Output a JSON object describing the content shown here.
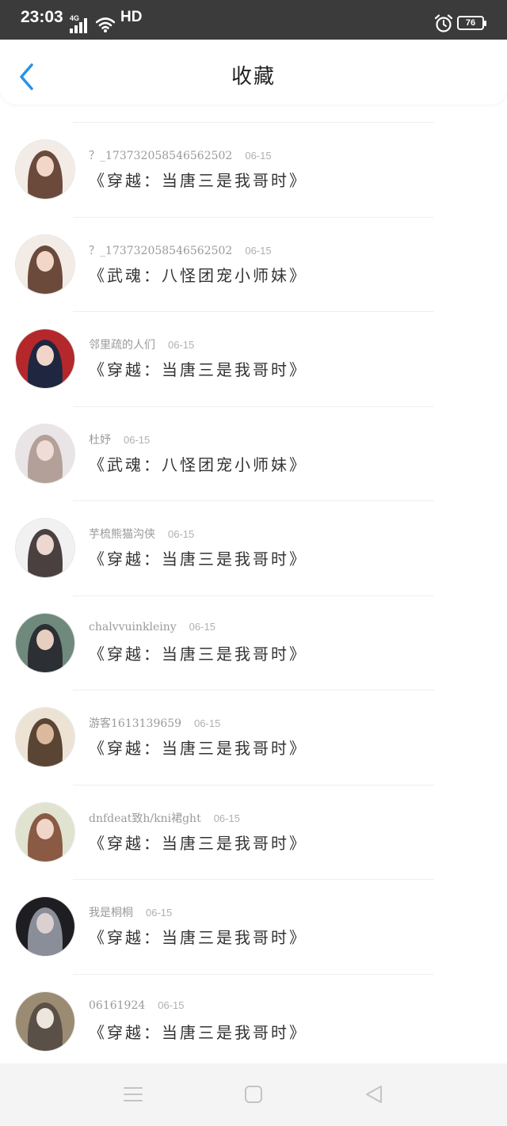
{
  "status_bar": {
    "time": "23:03",
    "network": "4G",
    "hd": "HD",
    "battery": "76"
  },
  "header": {
    "title": "收藏"
  },
  "items": [
    {
      "user": "？_173732058546562502",
      "date": "06-15",
      "title": "《穿越：当唐三是我哥时》",
      "avatar_colors": [
        "#f3ece6",
        "#6b4a3c",
        "#f2d7c9"
      ]
    },
    {
      "user": "？_173732058546562502",
      "date": "06-15",
      "title": "《武魂：八怪团宠小师妹》",
      "avatar_colors": [
        "#f3ece6",
        "#6b4a3c",
        "#f2d7c9"
      ]
    },
    {
      "user": "邻里疏的人们",
      "date": "06-15",
      "title": "《穿越：当唐三是我哥时》",
      "avatar_colors": [
        "#b4282c",
        "#1f2740",
        "#f0d5c8"
      ]
    },
    {
      "user": "杜妤",
      "date": "06-15",
      "title": "《武魂：八怪团宠小师妹》",
      "avatar_colors": [
        "#e9e4e6",
        "#b3a098",
        "#f0dcd6"
      ]
    },
    {
      "user": "芋梳熊猫沟侠",
      "date": "06-15",
      "title": "《穿越：当唐三是我哥时》",
      "avatar_colors": [
        "#f1f1f1",
        "#4a4040",
        "#ecd8d0"
      ]
    },
    {
      "user": "chalvvuinkleiny",
      "date": "06-15",
      "title": "《穿越：当唐三是我哥时》",
      "avatar_colors": [
        "#6f8a7c",
        "#2c2f33",
        "#e6cfc0"
      ]
    },
    {
      "user": "游客1613139659",
      "date": "06-15",
      "title": "《穿越：当唐三是我哥时》",
      "avatar_colors": [
        "#ede3d5",
        "#5a4535",
        "#dcb89c"
      ]
    },
    {
      "user": "dnfdeat致h/kni裙ght",
      "date": "06-15",
      "title": "《穿越：当唐三是我哥时》",
      "avatar_colors": [
        "#dfe3cf",
        "#8a5a44",
        "#f0d6c8"
      ]
    },
    {
      "user": "我是桐桐",
      "date": "06-15",
      "title": "《穿越：当唐三是我哥时》",
      "avatar_colors": [
        "#1e1e22",
        "#8a8e98",
        "#d9d0cf"
      ]
    },
    {
      "user": "06161924",
      "date": "06-15",
      "title": "《穿越：当唐三是我哥时》",
      "avatar_colors": [
        "#9a8b72",
        "#5a5048",
        "#ece6dc"
      ]
    }
  ],
  "colors": {
    "accent": "#2a92e8",
    "status_bar": "#3b3b3b",
    "nav_bar": "#f4f4f4"
  }
}
